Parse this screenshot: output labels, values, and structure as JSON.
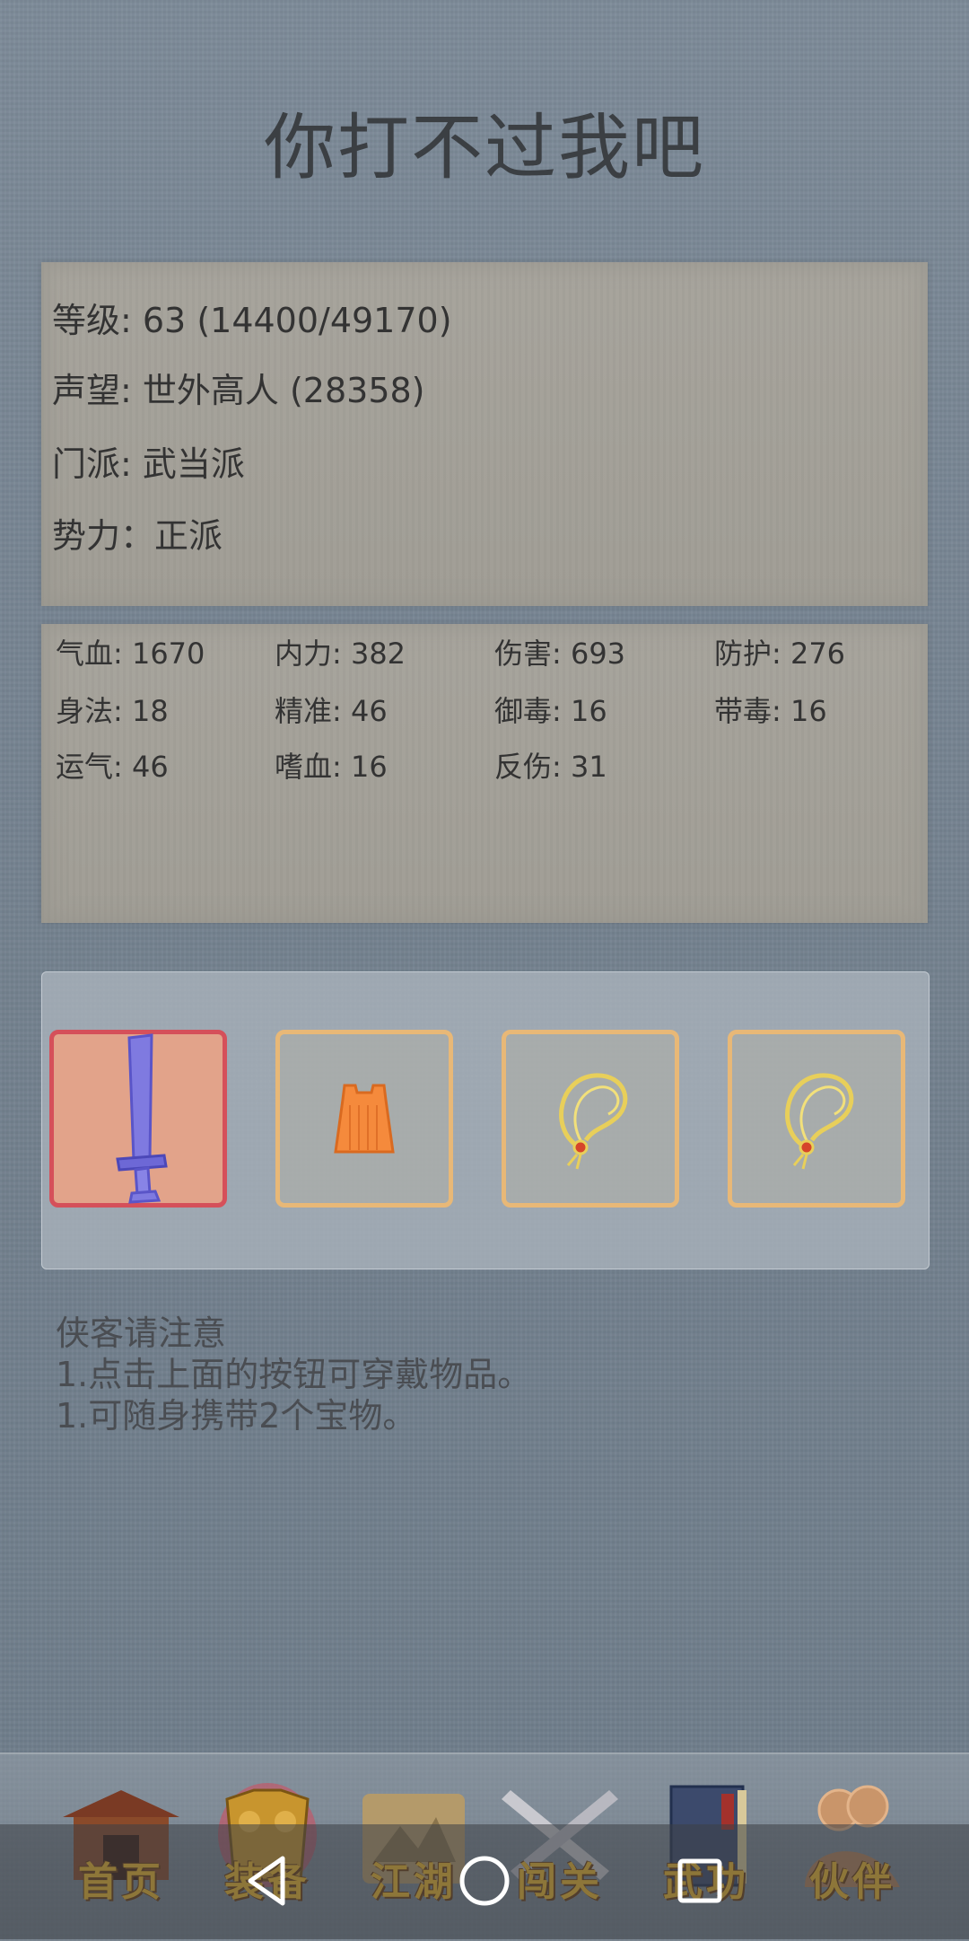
{
  "header": {
    "title": "你打不过我吧"
  },
  "profile": {
    "level": "等级: 63 (14400/49170)",
    "reputation": "声望: 世外高人 (28358)",
    "sect": "门派: 武当派",
    "faction": "势力：正派"
  },
  "stats": [
    "气血: 1670",
    "内力: 382",
    "伤害: 693",
    "防护: 276",
    "身法: 18",
    "精准: 46",
    "御毒: 16",
    "带毒: 16",
    "运气: 46",
    "嗜血: 16",
    "反伤: 31"
  ],
  "equipment": {
    "slots": [
      {
        "icon": "sword-icon",
        "selected": true
      },
      {
        "icon": "armor-icon",
        "selected": false
      },
      {
        "icon": "necklace-icon",
        "selected": false
      },
      {
        "icon": "necklace-icon",
        "selected": false
      }
    ]
  },
  "notice": {
    "heading": "侠客请注意",
    "line1": "1.点击上面的按钮可穿戴物品。",
    "line2": "1.可随身携带2个宝物。"
  },
  "tabbar": {
    "tabs": [
      {
        "label": "首页",
        "icon": "temple-icon"
      },
      {
        "label": "装备",
        "icon": "armor-icon",
        "active": true
      },
      {
        "label": "江湖",
        "icon": "scroll-map-icon"
      },
      {
        "label": "闯关",
        "icon": "crossed-swords-icon"
      },
      {
        "label": "武功",
        "icon": "book-icon"
      },
      {
        "label": "伙伴",
        "icon": "partners-icon"
      }
    ]
  },
  "colors": {
    "background": "#74828f",
    "title_text": "#3b3f43",
    "tab_label": "#f0b92b",
    "slot_border": "#e8b877",
    "slot_selected_border": "#d5505a"
  }
}
